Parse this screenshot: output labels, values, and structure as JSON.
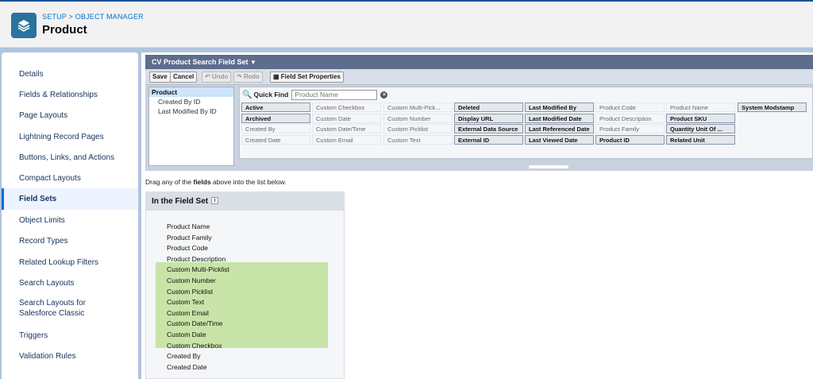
{
  "header": {
    "breadcrumb": "SETUP > OBJECT MANAGER",
    "title": "Product",
    "icon": "layers-icon"
  },
  "sidebar": {
    "items": [
      {
        "label": "Details"
      },
      {
        "label": "Fields & Relationships"
      },
      {
        "label": "Page Layouts"
      },
      {
        "label": "Lightning Record Pages"
      },
      {
        "label": "Buttons, Links, and Actions"
      },
      {
        "label": "Compact Layouts"
      },
      {
        "label": "Field Sets",
        "active": true
      },
      {
        "label": "Object Limits"
      },
      {
        "label": "Record Types"
      },
      {
        "label": "Related Lookup Filters"
      },
      {
        "label": "Search Layouts"
      },
      {
        "label": "Search Layouts for Salesforce Classic"
      },
      {
        "label": "Triggers"
      },
      {
        "label": "Validation Rules"
      }
    ]
  },
  "editor": {
    "title": "CV Product Search Field Set",
    "toolbar": {
      "save": "Save",
      "cancel": "Cancel",
      "undo": "Undo",
      "redo": "Redo",
      "properties": "Field Set Properties"
    },
    "categories": [
      "Product",
      "Created By ID",
      "Last Modified By ID"
    ],
    "quick_find": {
      "label": "Quick Find",
      "placeholder": "Product Name"
    },
    "fields": [
      [
        "Active",
        "Custom Checkbox",
        "Custom Multi-Pick...",
        "Deleted",
        "Last Modified By",
        "Product Code",
        "Product Name",
        "System Modstamp"
      ],
      [
        "Archived",
        "Custom Date",
        "Custom Number",
        "Display URL",
        "Last Modified Date",
        "Product Description",
        "Product SKU"
      ],
      [
        "Created By",
        "Custom Date/Time",
        "Custom Picklist",
        "External Data Source",
        "Last Referenced Date",
        "Product Family",
        "Quantity Unit Of ..."
      ],
      [
        "Created Date",
        "Custom Email",
        "Custom Text",
        "External ID",
        "Last Viewed Date",
        "Product ID",
        "Related Unit"
      ]
    ],
    "available_fields": [
      "Active",
      "Archived",
      "Deleted",
      "Display URL",
      "External Data Source",
      "External ID",
      "Last Modified By",
      "Last Modified Date",
      "Last Referenced Date",
      "Last Viewed Date",
      "Product ID",
      "Product SKU",
      "Quantity Unit Of ...",
      "Related Unit",
      "System Modstamp"
    ],
    "drag_hint": {
      "prefix": "Drag any of the ",
      "bold": "fields",
      "suffix": " above into the list below."
    }
  },
  "field_set": {
    "heading": "In the Field Set",
    "items": [
      {
        "label": "Product Name",
        "highlight": false
      },
      {
        "label": "Product Family",
        "highlight": false
      },
      {
        "label": "Product Code",
        "highlight": false
      },
      {
        "label": "Product Description",
        "highlight": false
      },
      {
        "label": "Custom Multi-Picklist",
        "highlight": true
      },
      {
        "label": "Custom Number",
        "highlight": true
      },
      {
        "label": "Custom Picklist",
        "highlight": true
      },
      {
        "label": "Custom Text",
        "highlight": true
      },
      {
        "label": "Custom Email",
        "highlight": true
      },
      {
        "label": "Custom Date/Time",
        "highlight": true
      },
      {
        "label": "Custom Date",
        "highlight": true
      },
      {
        "label": "Custom Checkbox",
        "highlight": true
      },
      {
        "label": "Created By",
        "highlight": false
      },
      {
        "label": "Created Date",
        "highlight": false
      }
    ]
  },
  "colors": {
    "accent": "#0070d2",
    "highlight": "#c8e4a8",
    "header_bar": "#5d6e8c"
  }
}
